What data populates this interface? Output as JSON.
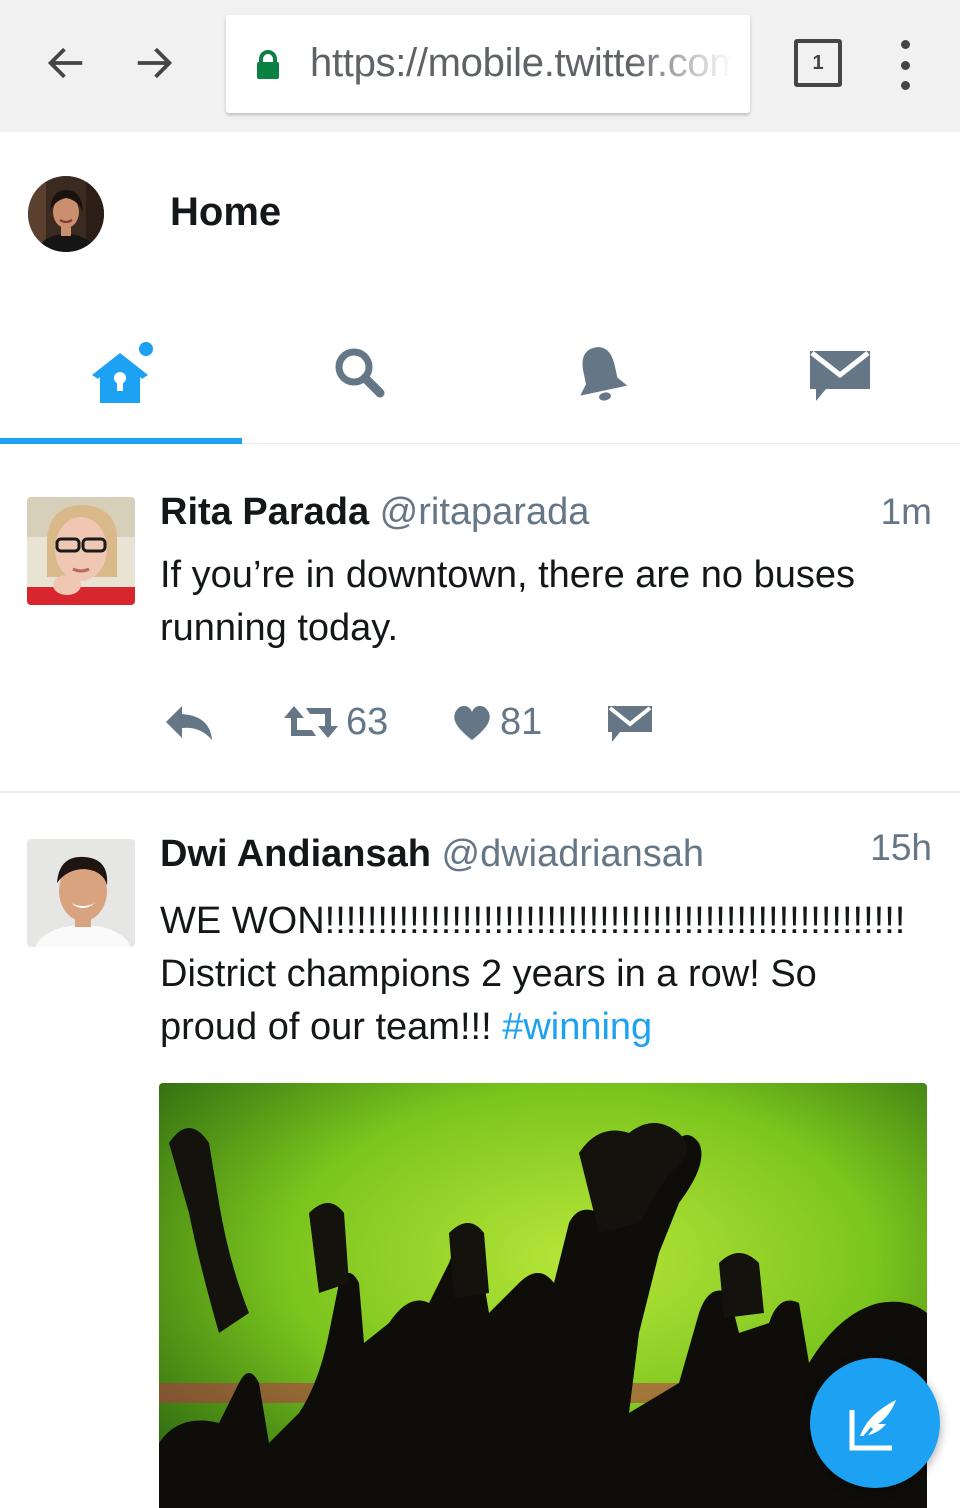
{
  "browser": {
    "url": "https://mobile.twitter.com",
    "tab_count": "1",
    "icons": {
      "back": "arrow-left-icon",
      "forward": "arrow-right-icon",
      "lock": "lock-icon",
      "menu": "more-vert-icon"
    }
  },
  "header": {
    "title": "Home",
    "avatar_icon": "profile-avatar"
  },
  "tabs": [
    {
      "name": "home",
      "icon": "home-icon",
      "active": true,
      "notification_dot": true
    },
    {
      "name": "search",
      "icon": "search-icon",
      "active": false
    },
    {
      "name": "notifications",
      "icon": "bell-icon",
      "active": false
    },
    {
      "name": "messages",
      "icon": "envelope-icon",
      "active": false
    }
  ],
  "tweets": [
    {
      "name": "Rita Parada",
      "handle": "@ritaparada",
      "time": "1m",
      "text": "If you’re in downtown, there are no buses running today.",
      "retweets": "63",
      "likes": "81"
    },
    {
      "name": "Dwi Andiansah",
      "handle": "@dwiadriansah",
      "time": "15h",
      "text": "WE WON!!!!!!!!!!!!!!!!!!!!!!!!!!!!!!!!!!!!!!!!!!!!!!!!!!!!!!! District champions 2 years in a row! So proud of our team!!! ",
      "hashtag": "#winning",
      "media": "crowd-cheering-photo"
    }
  ],
  "colors": {
    "accent": "#1da1f2",
    "icon_gray": "#657786",
    "text": "#14171a"
  },
  "compose_icon": "compose-tweet-icon"
}
